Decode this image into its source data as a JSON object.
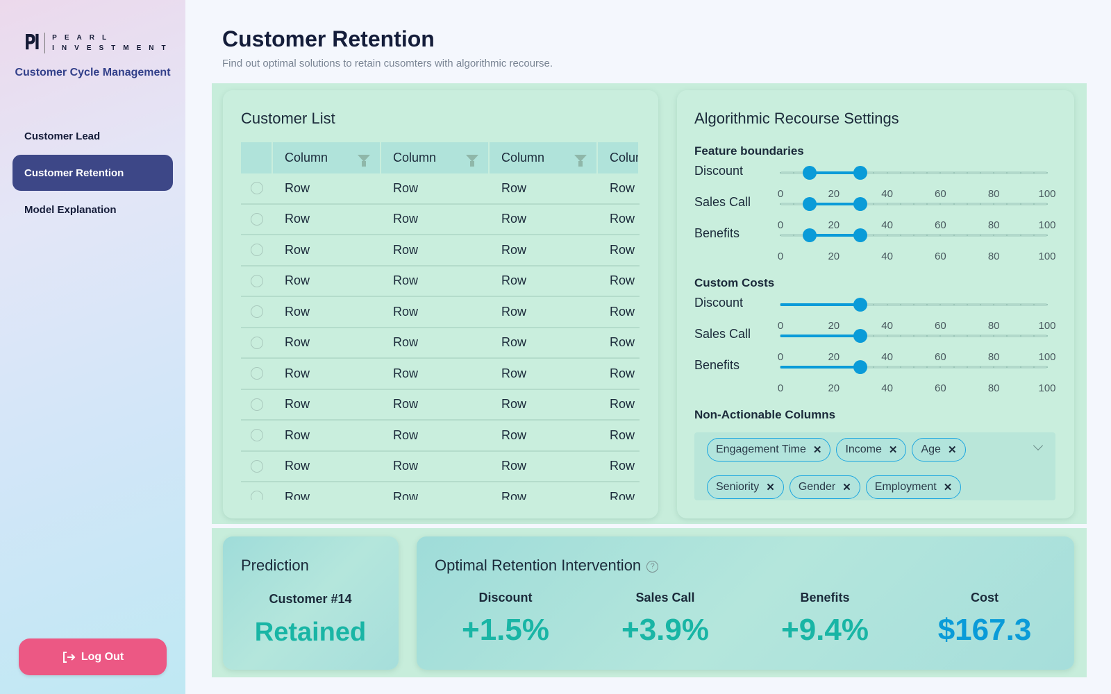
{
  "sidebar": {
    "logo_mark": "PI",
    "logo_line1": "PEARL",
    "logo_line2": "INVESTMENT",
    "app_name": "Customer Cycle Management",
    "items": [
      {
        "label": "Customer Lead",
        "active": false
      },
      {
        "label": "Customer Retention",
        "active": true
      },
      {
        "label": "Model Explanation",
        "active": false
      }
    ],
    "logout_label": "Log Out"
  },
  "header": {
    "title": "Customer Retention",
    "subtitle": "Find out optimal solutions to retain cusomters with algorithmic recourse."
  },
  "customer_list": {
    "title": "Customer List",
    "columns": [
      "Column",
      "Column",
      "Column",
      "Column"
    ],
    "rows": [
      [
        "Row",
        "Row",
        "Row",
        "Row"
      ],
      [
        "Row",
        "Row",
        "Row",
        "Row"
      ],
      [
        "Row",
        "Row",
        "Row",
        "Row"
      ],
      [
        "Row",
        "Row",
        "Row",
        "Row"
      ],
      [
        "Row",
        "Row",
        "Row",
        "Row"
      ],
      [
        "Row",
        "Row",
        "Row",
        "Row"
      ],
      [
        "Row",
        "Row",
        "Row",
        "Row"
      ],
      [
        "Row",
        "Row",
        "Row",
        "Row"
      ],
      [
        "Row",
        "Row",
        "Row",
        "Row"
      ],
      [
        "Row",
        "Row",
        "Row",
        "Row"
      ],
      [
        "Row",
        "Row",
        "Row",
        "Row"
      ]
    ]
  },
  "settings": {
    "title": "Algorithmic Recourse Settings",
    "ticks": [
      "0",
      "20",
      "40",
      "60",
      "80",
      "100"
    ],
    "feature_boundaries": {
      "title": "Feature boundaries",
      "sliders": [
        {
          "label": "Discount",
          "min": 11,
          "max": 30
        },
        {
          "label": "Sales Call",
          "min": 11,
          "max": 30
        },
        {
          "label": "Benefits",
          "min": 11,
          "max": 30
        }
      ]
    },
    "custom_costs": {
      "title": "Custom Costs",
      "sliders": [
        {
          "label": "Discount",
          "value": 30
        },
        {
          "label": "Sales Call",
          "value": 30
        },
        {
          "label": "Benefits",
          "value": 30
        }
      ]
    },
    "non_actionable": {
      "title": "Non-Actionable Columns",
      "chips": [
        "Engagement Time",
        "Income",
        "Age",
        "Seniority",
        "Gender",
        "Employment"
      ]
    }
  },
  "prediction": {
    "title": "Prediction",
    "customer": "Customer #14",
    "result": "Retained"
  },
  "intervention": {
    "title": "Optimal Retention Intervention",
    "help": "?",
    "metrics": [
      {
        "label": "Discount",
        "value": "+1.5%"
      },
      {
        "label": "Sales Call",
        "value": "+3.9%"
      },
      {
        "label": "Benefits",
        "value": "+9.4%"
      },
      {
        "label": "Cost",
        "value": "$167.3",
        "color": "#0a9bd8"
      }
    ]
  },
  "colors": {
    "accent": "#0a9bd8",
    "nav_active": "#3d4787",
    "logout": "#ec5884",
    "positive": "#19b5a5"
  }
}
